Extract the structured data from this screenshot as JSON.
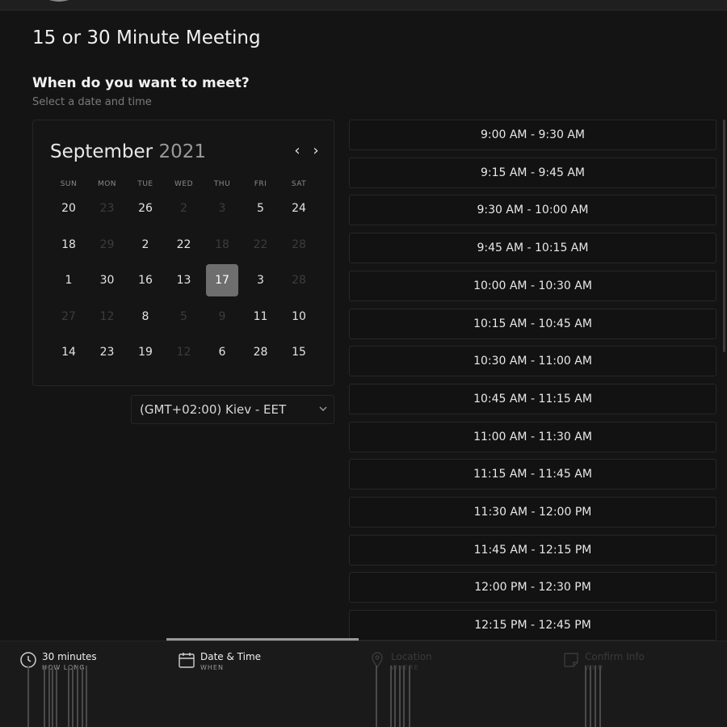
{
  "page": {
    "title": "15 or 30 Minute Meeting",
    "heading": "When do you want to meet?",
    "subheading": "Select a date and time"
  },
  "calendar": {
    "month": "September",
    "year": "2021",
    "prev_icon": "chevron-left-icon",
    "next_icon": "chevron-right-icon",
    "weekdays": [
      "SUN",
      "MON",
      "TUE",
      "WED",
      "THU",
      "FRI",
      "SAT"
    ],
    "weeks": [
      [
        {
          "d": "20",
          "s": "enabled"
        },
        {
          "d": "23",
          "s": "disabled"
        },
        {
          "d": "26",
          "s": "enabled"
        },
        {
          "d": "2",
          "s": "disabled"
        },
        {
          "d": "3",
          "s": "disabled"
        },
        {
          "d": "5",
          "s": "enabled"
        },
        {
          "d": "24",
          "s": "enabled"
        }
      ],
      [
        {
          "d": "18",
          "s": "enabled"
        },
        {
          "d": "29",
          "s": "disabled"
        },
        {
          "d": "2",
          "s": "enabled"
        },
        {
          "d": "22",
          "s": "enabled"
        },
        {
          "d": "18",
          "s": "disabled"
        },
        {
          "d": "22",
          "s": "disabled"
        },
        {
          "d": "28",
          "s": "disabled"
        }
      ],
      [
        {
          "d": "1",
          "s": "enabled"
        },
        {
          "d": "30",
          "s": "enabled"
        },
        {
          "d": "16",
          "s": "enabled"
        },
        {
          "d": "13",
          "s": "enabled"
        },
        {
          "d": "17",
          "s": "selected"
        },
        {
          "d": "3",
          "s": "enabled"
        },
        {
          "d": "28",
          "s": "disabled"
        }
      ],
      [
        {
          "d": "27",
          "s": "disabled"
        },
        {
          "d": "12",
          "s": "disabled"
        },
        {
          "d": "8",
          "s": "enabled"
        },
        {
          "d": "5",
          "s": "disabled"
        },
        {
          "d": "9",
          "s": "disabled"
        },
        {
          "d": "11",
          "s": "enabled"
        },
        {
          "d": "10",
          "s": "enabled"
        }
      ],
      [
        {
          "d": "14",
          "s": "enabled"
        },
        {
          "d": "23",
          "s": "enabled"
        },
        {
          "d": "19",
          "s": "enabled"
        },
        {
          "d": "12",
          "s": "disabled"
        },
        {
          "d": "6",
          "s": "enabled"
        },
        {
          "d": "28",
          "s": "enabled"
        },
        {
          "d": "15",
          "s": "enabled"
        }
      ]
    ]
  },
  "timezone": {
    "value": "(GMT+02:00) Kiev - EET",
    "icon": "chevron-down-icon"
  },
  "time_slots": [
    "9:00 AM - 9:30 AM",
    "9:15 AM - 9:45 AM",
    "9:30 AM - 10:00 AM",
    "9:45 AM - 10:15 AM",
    "10:00 AM - 10:30 AM",
    "10:15 AM - 10:45 AM",
    "10:30 AM - 11:00 AM",
    "10:45 AM - 11:15 AM",
    "11:00 AM - 11:30 AM",
    "11:15 AM - 11:45 AM",
    "11:30 AM - 12:00 PM",
    "11:45 AM - 12:15 PM",
    "12:00 PM - 12:30 PM",
    "12:15 PM - 12:45 PM"
  ],
  "steps": [
    {
      "label": "30 minutes",
      "sub": "HOW LONG",
      "icon": "clock-icon",
      "state": "active"
    },
    {
      "label": "Date & Time",
      "sub": "WHEN",
      "icon": "calendar-icon",
      "state": "active"
    },
    {
      "label": "Location",
      "sub": "WHERE",
      "icon": "location-pin-icon",
      "state": "inactive"
    },
    {
      "label": "Confirm Info",
      "sub": "WHO",
      "icon": "note-icon",
      "state": "inactive"
    }
  ],
  "colors": {
    "background": "#141414",
    "selected_day": "#6e6e6e",
    "disabled_day": "#3c3c3c"
  }
}
